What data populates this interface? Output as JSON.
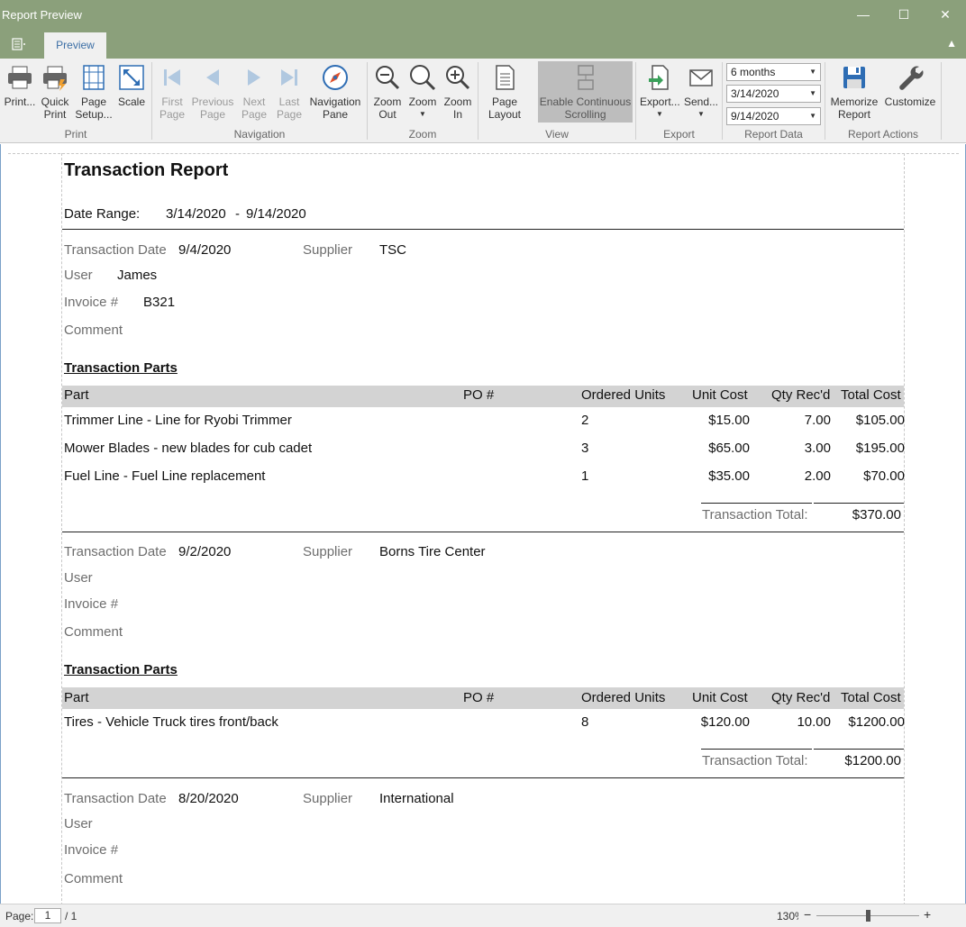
{
  "window": {
    "title": "Report Preview",
    "controls": [
      "—",
      "☐",
      "✕"
    ]
  },
  "ribbon": {
    "tab": "Preview",
    "groups": {
      "print": {
        "label": "Print",
        "print": "Print...",
        "quick_print": [
          "Quick",
          "Print"
        ],
        "page_setup": [
          "Page",
          "Setup..."
        ],
        "scale": "Scale"
      },
      "navigation": {
        "label": "Navigation",
        "first_page": [
          "First",
          "Page"
        ],
        "previous_page": [
          "Previous",
          "Page"
        ],
        "next_page": [
          "Next",
          "Page"
        ],
        "last_page": [
          "Last",
          "Page"
        ],
        "navigation_pane": [
          "Navigation",
          "Pane"
        ]
      },
      "zoom": {
        "label": "Zoom",
        "zoom_out": [
          "Zoom",
          "Out"
        ],
        "zoom": "Zoom",
        "zoom_in": [
          "Zoom",
          "In"
        ]
      },
      "view": {
        "label": "View",
        "page_layout": [
          "Page",
          "Layout"
        ],
        "continuous": [
          "Enable Continuous",
          "Scrolling"
        ]
      },
      "export": {
        "label": "Export",
        "export": "Export...",
        "send": "Send..."
      },
      "report_data": {
        "label": "Report Data",
        "period": "6 months",
        "start_date": "3/14/2020",
        "end_date": "9/14/2020"
      },
      "report_actions": {
        "label": "Report Actions",
        "memorize": [
          "Memorize",
          "Report"
        ],
        "customize": "Customize"
      }
    }
  },
  "report": {
    "title": "Transaction Report",
    "date_range_label": "Date Range:",
    "date_from": "3/14/2020",
    "date_sep": "-",
    "date_to": "9/14/2020",
    "labels": {
      "transaction_date": "Transaction Date",
      "supplier": "Supplier",
      "user": "User",
      "invoice": "Invoice #",
      "comment": "Comment",
      "parts_heading": "Transaction Parts",
      "transaction_total": "Transaction Total:"
    },
    "columns": [
      "Part",
      "PO #",
      "Ordered Units",
      "Unit Cost",
      "Qty Rec'd",
      "Total Cost"
    ],
    "transactions": [
      {
        "date": "9/4/2020",
        "supplier": "TSC",
        "user": "James",
        "invoice": "B321",
        "comment": "",
        "parts": [
          {
            "part": "Trimmer Line - Line for Ryobi Trimmer",
            "po": "",
            "ordered": "2",
            "unit_cost": "$15.00",
            "qty": "7.00",
            "total": "$105.00"
          },
          {
            "part": "Mower Blades - new blades for cub cadet",
            "po": "",
            "ordered": "3",
            "unit_cost": "$65.00",
            "qty": "3.00",
            "total": "$195.00"
          },
          {
            "part": "Fuel Line - Fuel Line replacement",
            "po": "",
            "ordered": "1",
            "unit_cost": "$35.00",
            "qty": "2.00",
            "total": "$70.00"
          }
        ],
        "total": "$370.00"
      },
      {
        "date": "9/2/2020",
        "supplier": "Borns Tire Center",
        "user": "",
        "invoice": "",
        "comment": "",
        "parts": [
          {
            "part": "Tires - Vehicle Truck tires front/back",
            "po": "",
            "ordered": "8",
            "unit_cost": "$120.00",
            "qty": "10.00",
            "total": "$1200.00"
          }
        ],
        "total": "$1200.00"
      },
      {
        "date": "8/20/2020",
        "supplier": "International",
        "user": "",
        "invoice": "",
        "comment": ""
      }
    ]
  },
  "status": {
    "page_label": "Page:",
    "page_value": "1",
    "page_total": "/ 1",
    "zoom": "130%",
    "zoom_level": 0.5
  }
}
